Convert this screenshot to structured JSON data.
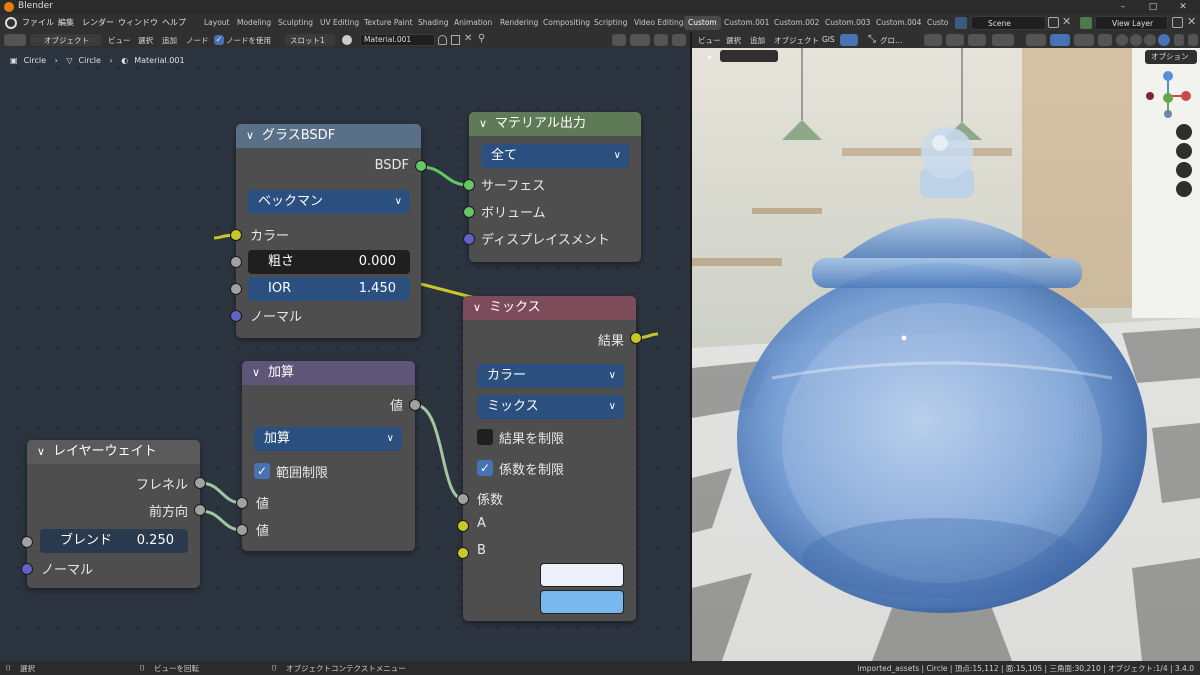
{
  "window": {
    "title": "Blender",
    "controls": [
      "–",
      "□",
      "✕"
    ]
  },
  "menubar": {
    "items": [
      "ファイル",
      "編集",
      "レンダー",
      "ウィンドウ",
      "ヘルプ"
    ],
    "workspaces": [
      "Layout",
      "Modeling",
      "Sculpting",
      "UV Editing",
      "Texture Paint",
      "Shading",
      "Animation",
      "Rendering",
      "Compositing",
      "Scripting",
      "Video Editing",
      "Custom",
      "Custom.001",
      "Custom.002",
      "Custom.003",
      "Custom.004",
      "Custo"
    ],
    "scene": "Scene",
    "view_layer": "View Layer"
  },
  "node_header": {
    "mode": "オブジェクト",
    "menus": [
      "ビュー",
      "選択",
      "追加",
      "ノード"
    ],
    "use_nodes_label": "ノードを使用",
    "slot": "スロット1",
    "material": "Material.001"
  },
  "breadcrumb": [
    "Circle",
    "Circle",
    "Material.001"
  ],
  "viewport_header": {
    "menus": [
      "ビュー",
      "選択",
      "追加",
      "オブジェクト",
      "GIS"
    ],
    "transform": "グロ…",
    "options": "オプション"
  },
  "nodes": {
    "glass": {
      "title": "グラスBSDF",
      "output": "BSDF",
      "distribution": "ベックマン",
      "color_label": "カラー",
      "roughness_label": "粗さ",
      "roughness_value": "0.000",
      "ior_label": "IOR",
      "ior_value": "1.450",
      "normal_label": "ノーマル"
    },
    "output": {
      "title": "マテリアル出力",
      "target": "全て",
      "surface": "サーフェス",
      "volume": "ボリューム",
      "displacement": "ディスプレイスメント"
    },
    "mix": {
      "title": "ミックス",
      "result": "結果",
      "data_type": "カラー",
      "blend_type": "ミックス",
      "clamp_result": "結果を制限",
      "clamp_factor": "係数を制限",
      "factor": "係数",
      "a": "A",
      "b": "B",
      "a_color": "#eef0fb",
      "b_color": "#78b8ee"
    },
    "add": {
      "title": "加算",
      "output": "値",
      "operation": "加算",
      "clamp": "範囲制限",
      "input1": "値",
      "input2": "値"
    },
    "layerweight": {
      "title": "レイヤーウェイト",
      "fresnel": "フレネル",
      "facing": "前方向",
      "blend_label": "ブレンド",
      "blend_value": "0.250",
      "normal_label": "ノーマル"
    }
  },
  "statusbar": {
    "select": "選択",
    "rotate": "ビューを回転",
    "context": "オブジェクトコンテクストメニュー",
    "stats": "imported_assets | Circle | 頂点:15,112 | 面:15,105 | 三角面:30,210 | オブジェクト:1/4 | 3.4.0"
  },
  "colors": {
    "accent": "#4772b3",
    "shader_header": "#5a7089",
    "output_header": "#5e7a57",
    "color_header": "#7d4c5a",
    "converter_header": "#5e5578",
    "input_header": "#5a5a5a"
  }
}
